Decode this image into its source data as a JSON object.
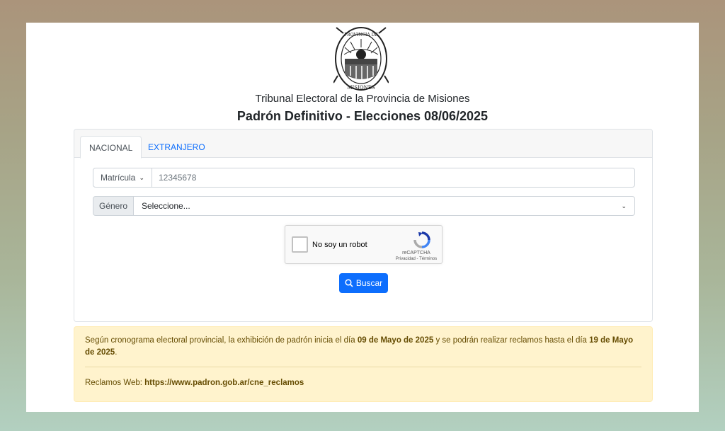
{
  "header": {
    "seal_top_text": "PROVINCIA DE",
    "seal_bottom_text": "MISIONES",
    "org_title": "Tribunal Electoral de la Provincia de Misiones",
    "page_title": "Padrón Definitivo - Elecciones 08/06/2025"
  },
  "tabs": [
    {
      "label": "NACIONAL",
      "active": true
    },
    {
      "label": "EXTRANJERO",
      "active": false
    }
  ],
  "form": {
    "doc_type_selected": "Matrícula",
    "doc_number_placeholder": "12345678",
    "gender_label": "Género",
    "gender_selected": "Seleccione...",
    "search_label": "Buscar"
  },
  "captcha": {
    "label": "No soy un robot",
    "brand": "reCAPTCHA",
    "terms": "Privacidad - Términos"
  },
  "notice": {
    "text_1": "Según cronograma electoral provincial, la exhibición de padrón inicia el día ",
    "date_start": "09 de Mayo de 2025",
    "text_2": " y se podrán realizar reclamos hasta el día ",
    "date_end": "19 de Mayo de 2025",
    "text_3": ".",
    "claims_label": "Reclamos Web: ",
    "claims_url": "https://www.padron.gob.ar/cne_reclamos"
  },
  "colors": {
    "primary": "#0d6efd",
    "alert_bg": "#fff3cd",
    "alert_text": "#664d03"
  }
}
